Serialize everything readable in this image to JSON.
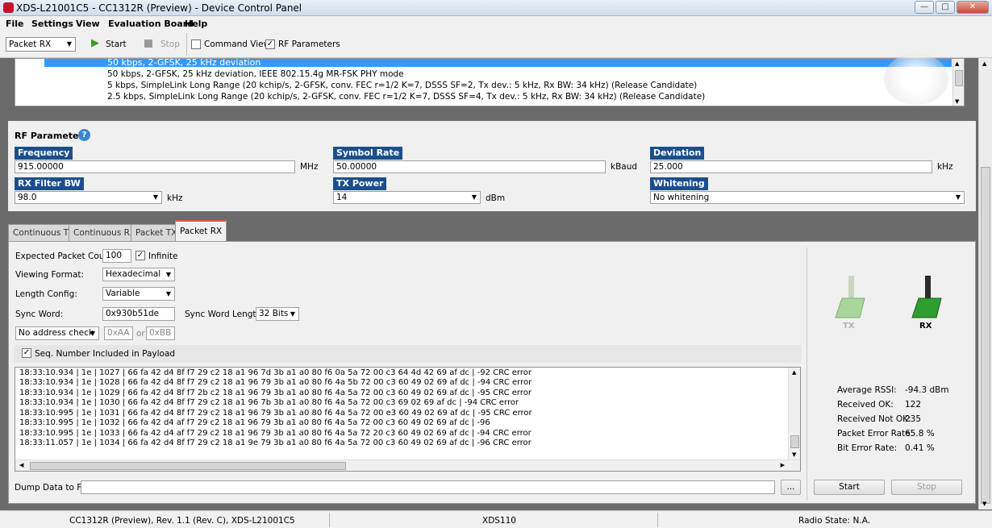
{
  "window": {
    "title": "XDS-L21001C5 - CC1312R (Preview) - Device Control Panel"
  },
  "menu": [
    "File",
    "Settings",
    "View",
    "Evaluation Board",
    "Help"
  ],
  "toolbar": {
    "mode": "Packet RX",
    "start": "Start",
    "stop": "Stop",
    "command_view": "Command View",
    "rf_parameters": "RF Parameters"
  },
  "phy_list": {
    "items": [
      "50 kbps, 2-GFSK, 25 kHz deviation",
      "50 kbps, 2-GFSK, 25 kHz deviation, IEEE 802.15.4g MR-FSK PHY mode",
      "5 kbps, SimpleLink Long Range (20 kchip/s, 2-GFSK, conv. FEC r=1/2 K=7, DSSS SF=2, Tx dev.: 5 kHz, Rx BW: 34 kHz) (Release Candidate)",
      "2.5 kbps, SimpleLink Long Range (20 kchip/s, 2-GFSK, conv. FEC r=1/2 K=7, DSSS SF=4, Tx dev.: 5 kHz, Rx BW: 34 kHz) (Release Candidate)"
    ]
  },
  "rf": {
    "title": "RF Parameters",
    "frequency": {
      "label": "Frequency",
      "value": "915.00000",
      "unit": "MHz"
    },
    "symbol_rate": {
      "label": "Symbol Rate",
      "value": "50.00000",
      "unit": "kBaud"
    },
    "deviation": {
      "label": "Deviation",
      "value": "25.000",
      "unit": "kHz"
    },
    "rx_filter_bw": {
      "label": "RX Filter BW",
      "value": "98.0",
      "unit": "kHz"
    },
    "tx_power": {
      "label": "TX Power",
      "value": "14",
      "unit": "dBm"
    },
    "whitening": {
      "label": "Whitening",
      "value": "No whitening"
    }
  },
  "tabs": [
    "Continuous TX",
    "Continuous RX",
    "Packet TX",
    "Packet RX"
  ],
  "packet_rx": {
    "expected_count_label": "Expected Packet Count:",
    "expected_count": "100",
    "infinite": "Infinite",
    "viewing_format_label": "Viewing Format:",
    "viewing_format": "Hexadecimal",
    "length_config_label": "Length Config:",
    "length_config": "Variable",
    "sync_word_label": "Sync Word:",
    "sync_word": "0x930b51de",
    "sync_word_length_label": "Sync Word Length:",
    "sync_word_length": "32 Bits",
    "address_check": "No address check",
    "addr1": "0xAA",
    "or": "or",
    "addr2": "0xBB",
    "seq_number": "Seq. Number Included in Payload",
    "log": [
      "18:33:10.934 | 1e | 1027 | 66 fa 42 d4 8f f7 29 c2 18 a1 96 7d 3b a1 a0 80 f6 0a 5a 72 00 c3 64 4d 42 69 af dc  |  -92 CRC error",
      "18:33:10.934 | 1e | 1028 | 66 fa 42 d4 8f f7 29 c2 18 a1 96 79 3b a1 a0 80 f6 4a 5b 72 00 c3 60 49 02 69 af dc  |  -94 CRC error",
      "18:33:10.934 | 1e | 1029 | 66 fa 42 d4 8f f7 2b c2 18 a1 96 79 3b a1 a0 80 f6 4a 5a 72 00 c3 60 49 02 69 af dc  |  -95 CRC error",
      "18:33:10.934 | 1e | 1030 | 66 fa 42 d4 8f f7 29 c2 18 a1 96 7b 3b a1 a0 80 f6 4a 5a 72 00 c3 69 02 69 af dc  |  -94 CRC error",
      "18:33:10.995 | 1e | 1031 | 66 fa 42 d4 8f f7 29 c2 18 a1 96 79 3b a1 a0 80 f6 4a 5a 72 00 e3 60 49 02 69 af dc  |  -95 CRC error",
      "18:33:10.995 | 1e | 1032 | 66 fa 42 d4 af f7 29 c2 18 a1 96 79 3b a1 a0 80 f6 4a 5a 72 00 c3 60 49 02 69 af dc  |  -96",
      "18:33:10.995 | 1e | 1033 | 66 fa 42 d4 af f7 29 c2 18 a1 96 79 3b a1 a0 80 f6 4a 5a 72 20 c3 60 49 02 69 af dc  |  -94 CRC error",
      "18:33:11.057 | 1e | 1034 | 66 fa 42 d4 8f f7 29 c2 18 a1 9e 79 3b a1 a0 80 f6 4a 5a 72 00 c3 60 49 02 69 af dc  |  -96 CRC error"
    ],
    "dump_label": "Dump Data to File:",
    "dump_value": "",
    "browse": "...",
    "start": "Start",
    "stop": "Stop"
  },
  "stats": {
    "tx_label": "TX",
    "rx_label": "RX",
    "avg_rssi_label": "Average RSSI:",
    "avg_rssi": "-94.3 dBm",
    "received_ok_label": "Received OK:",
    "received_ok": "122",
    "received_not_ok_label": "Received Not OK:",
    "received_not_ok": "235",
    "per_label": "Packet Error Rate:",
    "per": "65.8 %",
    "ber_label": "Bit Error Rate:",
    "ber": "0.41 %"
  },
  "statusbar": {
    "device": "CC1312R (Preview), Rev. 1.1 (Rev. C), XDS-L21001C5",
    "debugger": "XDS110",
    "radio_state": "Radio State: N.A."
  }
}
